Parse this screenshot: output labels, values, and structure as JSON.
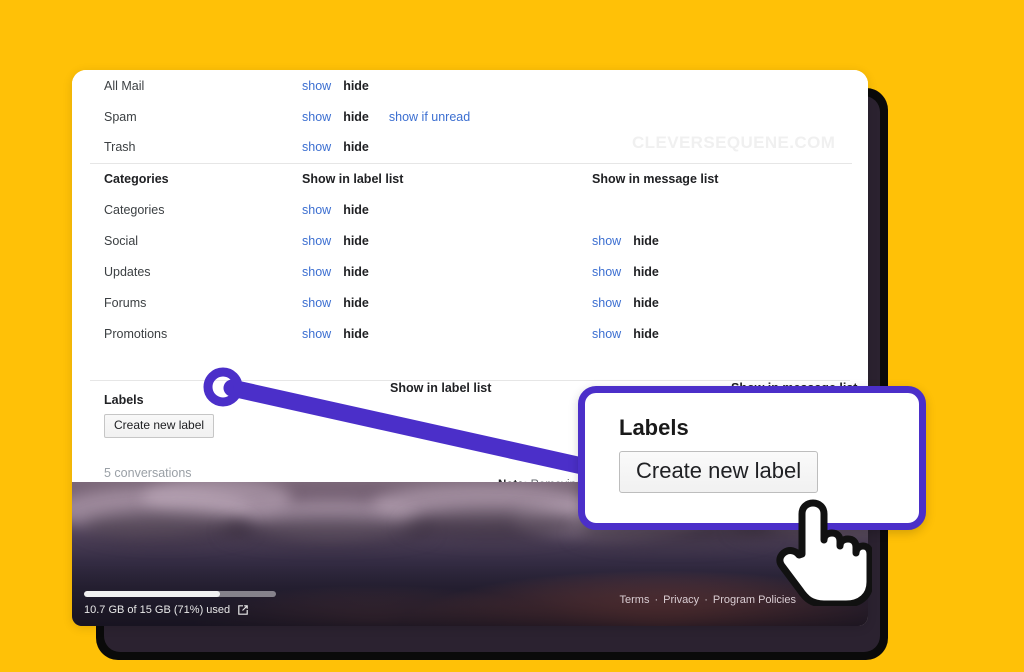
{
  "background": {
    "color": "#FFC107"
  },
  "theme": {
    "accent_purple": "#4B2FC9",
    "link_blue": "#3c6fd1",
    "frame_dark": "#0a0a0a"
  },
  "watermark": {
    "text": "CLEVERSEQUENE.COM"
  },
  "settings": {
    "system_rows": [
      {
        "name": "All Mail",
        "show": "show",
        "hide": "hide",
        "extra": ""
      },
      {
        "name": "Spam",
        "show": "show",
        "hide": "hide",
        "extra": "show if unread"
      },
      {
        "name": "Trash",
        "show": "show",
        "hide": "hide",
        "extra": ""
      }
    ],
    "categories_section": {
      "title": "Categories",
      "col_label_list": "Show in label list",
      "col_message_list": "Show in message list",
      "rows": [
        {
          "name": "Categories",
          "label_show": "show",
          "label_hide": "hide",
          "msg_show": "",
          "msg_hide": ""
        },
        {
          "name": "Social",
          "label_show": "show",
          "label_hide": "hide",
          "msg_show": "show",
          "msg_hide": "hide"
        },
        {
          "name": "Updates",
          "label_show": "show",
          "label_hide": "hide",
          "msg_show": "show",
          "msg_hide": "hide"
        },
        {
          "name": "Forums",
          "label_show": "show",
          "label_hide": "hide",
          "msg_show": "show",
          "msg_hide": "hide"
        },
        {
          "name": "Promotions",
          "label_show": "show",
          "label_hide": "hide",
          "msg_show": "show",
          "msg_hide": "hide"
        }
      ]
    },
    "labels_section": {
      "title": "Labels",
      "col_label_list": "Show in label list",
      "col_message_list": "Show in message list",
      "create_button": "Create new label",
      "conversations": "5 conversations",
      "note_prefix": "Note:",
      "note_text": " Removing a label will not r"
    }
  },
  "storage": {
    "text": "10.7 GB of 15 GB (71%) used",
    "percent": 71,
    "icon": "external-link-icon"
  },
  "footer": {
    "terms": "Terms",
    "privacy": "Privacy",
    "policies": "Program Policies",
    "separator": "·"
  },
  "callout": {
    "title": "Labels",
    "button": "Create new label"
  },
  "cursor": {
    "type": "pointing-hand-cursor"
  }
}
